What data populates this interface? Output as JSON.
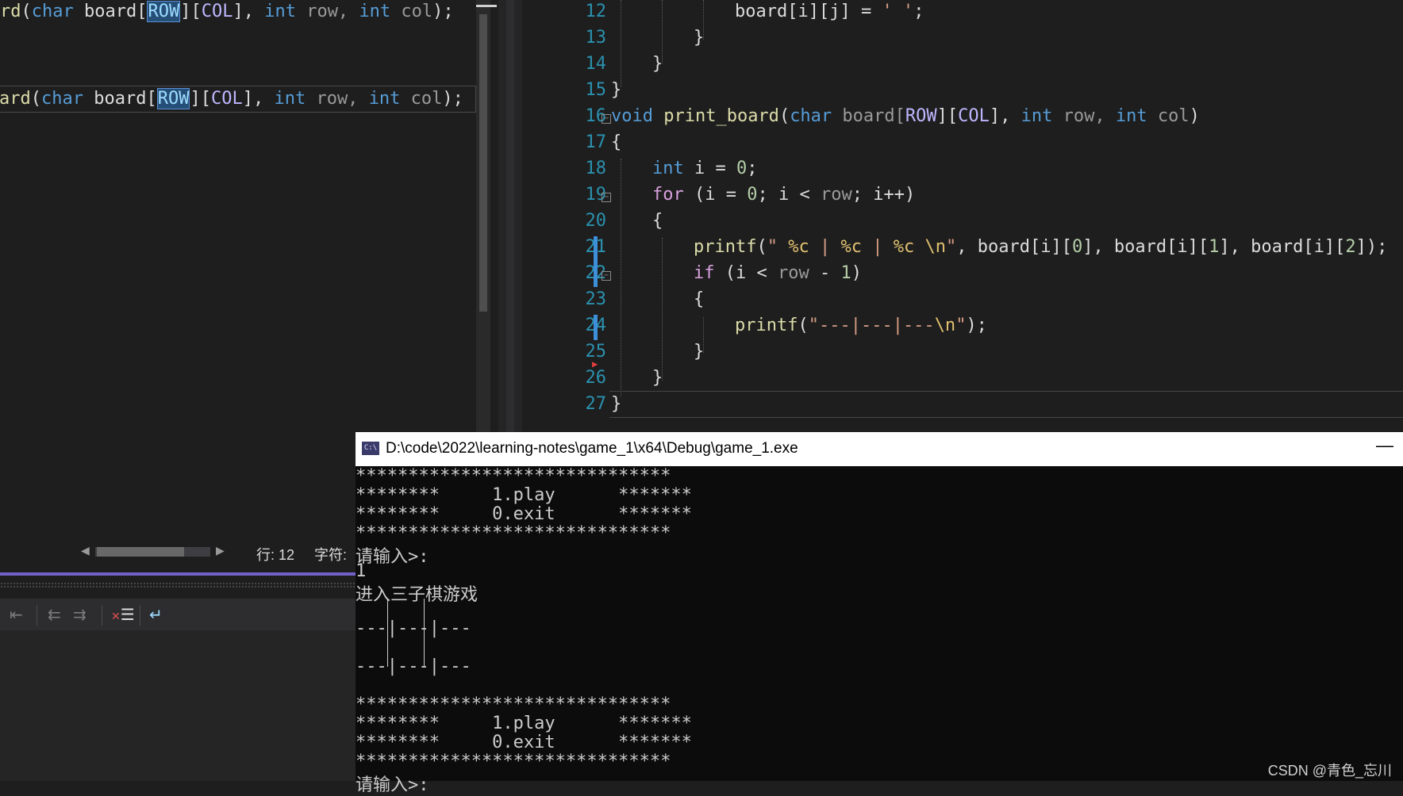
{
  "left_editor": {
    "line_top": {
      "prefix": "rd",
      "p1": "(",
      "kw1": "char",
      "s1": " board[",
      "macro_row": "ROW",
      "s2": "][",
      "macro_col": "COL",
      "s3": "], ",
      "kw2": "int",
      "p_row": " row, ",
      "kw3": "int",
      "p_col": " col",
      "end": ");"
    },
    "line_boxed": {
      "prefix": "ard",
      "p1": "(",
      "kw1": "char",
      "s1": " board[",
      "macro_row": "ROW",
      "s2": "][",
      "macro_col": "COL",
      "s3": "], ",
      "kw2": "int",
      "p_row": " row, ",
      "kw3": "int",
      "p_col": " col",
      "end": ");"
    },
    "status": {
      "line_label": "行: 12",
      "char_label": "字符:"
    }
  },
  "panel_toolbar": {
    "icons": [
      "outdent-icon",
      "decrease-indent-icon",
      "increase-indent-icon",
      "clear-all-icon",
      "word-wrap-icon"
    ]
  },
  "code_editor": {
    "line_numbers": [
      "12",
      "13",
      "14",
      "15",
      "16",
      "17",
      "18",
      "19",
      "20",
      "21",
      "22",
      "23",
      "24",
      "25",
      "26",
      "27"
    ],
    "lines": {
      "l12": {
        "a": "board[i][j] = ",
        "b": "' '",
        "c": ";"
      },
      "l13": {
        "a": "}"
      },
      "l14": {
        "a": "}"
      },
      "l15": {
        "a": "}"
      },
      "l16": {
        "kw": "void",
        "fn": " print_board",
        "p1": "(",
        "kw2": "char",
        "s1": " board[",
        "m1": "ROW",
        "s2": "][",
        "m2": "COL",
        "s3": "], ",
        "kw3": "int",
        "pr": " row, ",
        "kw4": "int",
        "pc": " col",
        "end": ")"
      },
      "l17": {
        "a": "{"
      },
      "l18": {
        "kw": "int",
        "a": " i = ",
        "n": "0",
        "b": ";"
      },
      "l19": {
        "ctl": "for",
        "a": " (i = ",
        "n": "0",
        "b": "; i < ",
        "pr": "row",
        "c": "; i++)"
      },
      "l20": {
        "a": "{"
      },
      "l21": {
        "fn": "printf",
        "a": "(",
        "s1": "\" ",
        "e1": "%c",
        "s2": " | ",
        "e2": "%c",
        "s3": " | ",
        "e3": "%c",
        "s4": " ",
        "e4": "\\n",
        "s5": "\"",
        "b": ", board[i][",
        "n0": "0",
        "c": "], board[i][",
        "n1": "1",
        "d": "], board[i][",
        "n2": "2",
        "e": "]);"
      },
      "l22": {
        "ctl": "if",
        "a": " (i < ",
        "pr": "row",
        "b": " - ",
        "n": "1",
        "c": ")"
      },
      "l23": {
        "a": "{"
      },
      "l24": {
        "fn": "printf",
        "a": "(",
        "s1": "\"---|---|---",
        "e1": "\\n",
        "s2": "\"",
        "b": ");"
      },
      "l25": {
        "a": "}"
      },
      "l26": {
        "a": "}"
      },
      "l27": {
        "a": "}"
      }
    }
  },
  "console": {
    "title": "D:\\code\\2022\\learning-notes\\game_1\\x64\\Debug\\game_1.exe",
    "icon_label": "C:\\",
    "minimize": "—",
    "lines": [
      "******************************",
      "********     1.play      *******",
      "********     0.exit      *******",
      "******************************",
      "请输入>:",
      "1",
      "进入三子棋游戏",
      "---|---|---",
      "---|---|---",
      "******************************",
      "********     1.play      *******",
      "********     0.exit      *******",
      "******************************",
      "请输入>:"
    ]
  },
  "watermark": "CSDN @青色_忘川",
  "colors": {
    "keyword": "#569cd6",
    "control": "#d8a0df",
    "function": "#dcdcaa",
    "macro": "#beb7ff",
    "number": "#b5cea8",
    "string": "#d69d85",
    "line_number": "#2b91af",
    "accent": "#7161c9"
  }
}
